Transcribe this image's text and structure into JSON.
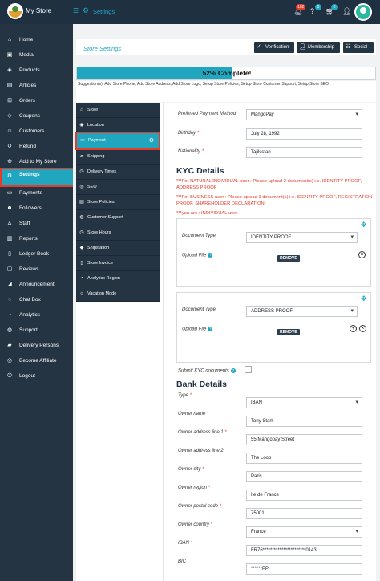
{
  "topbar": {
    "store_name": "My Store",
    "section_title": "Settings",
    "badges": {
      "notifications": "102",
      "help": "0",
      "orders": "0"
    }
  },
  "sidebar": {
    "items": [
      {
        "label": "Home",
        "icon": "home-icon"
      },
      {
        "label": "Media",
        "icon": "media-icon"
      },
      {
        "label": "Products",
        "icon": "cube-icon"
      },
      {
        "label": "Articles",
        "icon": "articles-icon"
      },
      {
        "label": "Orders",
        "icon": "cart-icon"
      },
      {
        "label": "Coupons",
        "icon": "gift-icon"
      },
      {
        "label": "Customers",
        "icon": "users-icon"
      },
      {
        "label": "Refund",
        "icon": "refund-icon"
      },
      {
        "label": "Add to My Store",
        "icon": "plus-square-icon"
      },
      {
        "label": "Settings",
        "icon": "cogs-icon"
      },
      {
        "label": "Payments",
        "icon": "money-icon"
      },
      {
        "label": "Followers",
        "icon": "followers-icon"
      },
      {
        "label": "Staff",
        "icon": "staff-icon"
      },
      {
        "label": "Reports",
        "icon": "chart-icon"
      },
      {
        "label": "Ledger Book",
        "icon": "book-icon"
      },
      {
        "label": "Reviews",
        "icon": "comments-icon"
      },
      {
        "label": "Announcement",
        "icon": "bullhorn-icon"
      },
      {
        "label": "Chat Box",
        "icon": "chat-icon"
      },
      {
        "label": "Analytics",
        "icon": "analytics-icon"
      },
      {
        "label": "Support",
        "icon": "support-icon"
      },
      {
        "label": "Delivery Persons",
        "icon": "truck-icon"
      },
      {
        "label": "Become Affiliate",
        "icon": "affiliate-icon"
      },
      {
        "label": "Logout",
        "icon": "power-icon"
      }
    ],
    "active_index": 9
  },
  "header": {
    "title": "Store Settings",
    "buttons": {
      "verification": "Verification",
      "membership": "Membership",
      "social": "Social"
    }
  },
  "progress": {
    "text": "52% Complete!",
    "value": 0.52
  },
  "suggestions": "Suggestion(s): Add Store Phone, Add Store Address, Add Store Logo, Setup Store Policies, Setup Store Customer Support, Setup Store SEO",
  "settings_menu": {
    "items": [
      {
        "label": "Store",
        "icon": "store-icon"
      },
      {
        "label": "Location",
        "icon": "location-icon"
      },
      {
        "label": "Payment",
        "icon": "payment-icon"
      },
      {
        "label": "Shipping",
        "icon": "truck-icon"
      },
      {
        "label": "Delivery Times",
        "icon": "clock-icon"
      },
      {
        "label": "SEO",
        "icon": "globe-icon"
      },
      {
        "label": "Store Policies",
        "icon": "policy-icon"
      },
      {
        "label": "Customer Support",
        "icon": "support-icon"
      },
      {
        "label": "Store Hours",
        "icon": "clock-icon"
      },
      {
        "label": "Shipstation",
        "icon": "ship-icon"
      },
      {
        "label": "Store Invoice",
        "icon": "invoice-icon"
      },
      {
        "label": "Analytics Region",
        "icon": "analytics-icon"
      },
      {
        "label": "Vacation Mode",
        "icon": "vacation-icon"
      }
    ],
    "active_index": 2
  },
  "form": {
    "preferred_payment": {
      "label": "Preferred Payment Method",
      "value": "MangoPay"
    },
    "birthday": {
      "label": "Birthday",
      "value": "July 28, 1992"
    },
    "nationality": {
      "label": "Nationality",
      "value": "Tajikistan"
    },
    "kyc_title": "KYC Details",
    "kyc_notes": [
      "***For NATURAL/INDIVIDUAL user : Please upload 2 document(s) i.e. IDENTITY PROOF, ADDRESS PROOF",
      "***For BUSINESS user : Please upload 3 document(s) i.e. IDENTITY PROOF, REGISTRATION PROOF, SHAREHOLDER DECLARATION",
      "***you are : INDIVIDUAL user"
    ],
    "kyc_docs": [
      {
        "type_label": "Document Type",
        "type_value": "IDENTITY PROOF",
        "upload_label": "Upload File",
        "remove_label": "REMOVE"
      },
      {
        "type_label": "Document Type",
        "type_value": "ADDRESS PROOF",
        "upload_label": "Upload File",
        "remove_label": "REMOVE"
      }
    ],
    "submit_kyc_label": "Submit KYC documents",
    "bank_title": "Bank Details",
    "bank_fields": [
      {
        "label": "Type",
        "required": true,
        "value": "IBAN",
        "select": true
      },
      {
        "label": "Owner name",
        "required": true,
        "value": "Tony Stark",
        "select": false
      },
      {
        "label": "Owner address line 1",
        "required": true,
        "value": "55 Mangopay Street",
        "select": false
      },
      {
        "label": "Owner address line 2",
        "required": false,
        "value": "The Loop",
        "select": false
      },
      {
        "label": "Owner city",
        "required": true,
        "value": "Paris",
        "select": false
      },
      {
        "label": "Owner region",
        "required": true,
        "value": "Ile de France",
        "select": false
      },
      {
        "label": "Owner postal code",
        "required": true,
        "value": "75001",
        "select": false
      },
      {
        "label": "Owner country",
        "required": true,
        "value": "France",
        "select": true
      },
      {
        "label": "IBAN",
        "required": true,
        "value": "FR76***********************0143",
        "select": false
      },
      {
        "label": "BIC",
        "required": false,
        "value": "******PP",
        "select": false
      }
    ]
  },
  "colors": {
    "accent": "#21a6c0",
    "sidebar": "#253442",
    "highlight": "#e53b2b"
  }
}
